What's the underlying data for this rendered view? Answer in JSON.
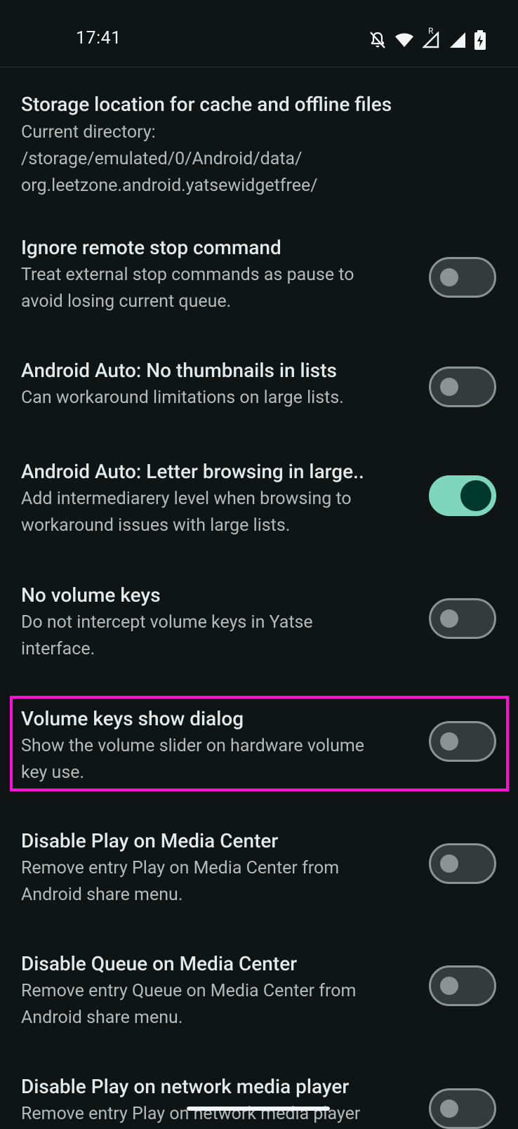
{
  "status_bar": {
    "time": "17:41",
    "icons": [
      "notifications-off-icon",
      "wifi-icon",
      "cell-signal-roaming-icon",
      "cell-signal-icon",
      "battery-charging-icon"
    ],
    "roaming_label": "R"
  },
  "settings": {
    "storage": {
      "title": "Storage location for cache and offline files",
      "summary_lines": [
        "Current directory:",
        "/storage/emulated/0/Android/data/",
        "org.leetzone.android.yatsewidgetfree/"
      ]
    },
    "items": [
      {
        "title": "Ignore remote stop command",
        "summary_lines": [
          "Treat external stop commands as pause to",
          "avoid losing current queue."
        ],
        "enabled": false
      },
      {
        "title": "Android Auto: No thumbnails in lists",
        "summary_lines": [
          "Can workaround limitations on large lists."
        ],
        "enabled": false
      },
      {
        "title": "Android Auto: Letter browsing in large..",
        "summary_lines": [
          "Add intermediarery level when browsing to",
          "workaround issues with large lists."
        ],
        "enabled": true
      },
      {
        "title": "No volume keys",
        "summary_lines": [
          "Do not intercept volume keys in Yatse",
          "interface."
        ],
        "enabled": false
      },
      {
        "title": "Volume keys show dialog",
        "summary_lines": [
          "Show the volume slider on hardware volume",
          "key use."
        ],
        "enabled": false
      },
      {
        "title": "Disable Play on Media Center",
        "summary_lines": [
          "Remove entry Play on Media Center from",
          "Android share menu."
        ],
        "enabled": false
      },
      {
        "title": "Disable Queue on Media Center",
        "summary_lines": [
          "Remove entry Queue on Media Center from",
          "Android share menu."
        ],
        "enabled": false
      },
      {
        "title": "Disable Play on network media player",
        "summary_lines": [
          "Remove entry Play on network media player"
        ],
        "enabled": false
      }
    ]
  },
  "colors": {
    "background": "#0e1514",
    "switch_on": "#7fd6bd",
    "switch_off_border": "#8a9492",
    "highlight": "#ff10d8"
  }
}
